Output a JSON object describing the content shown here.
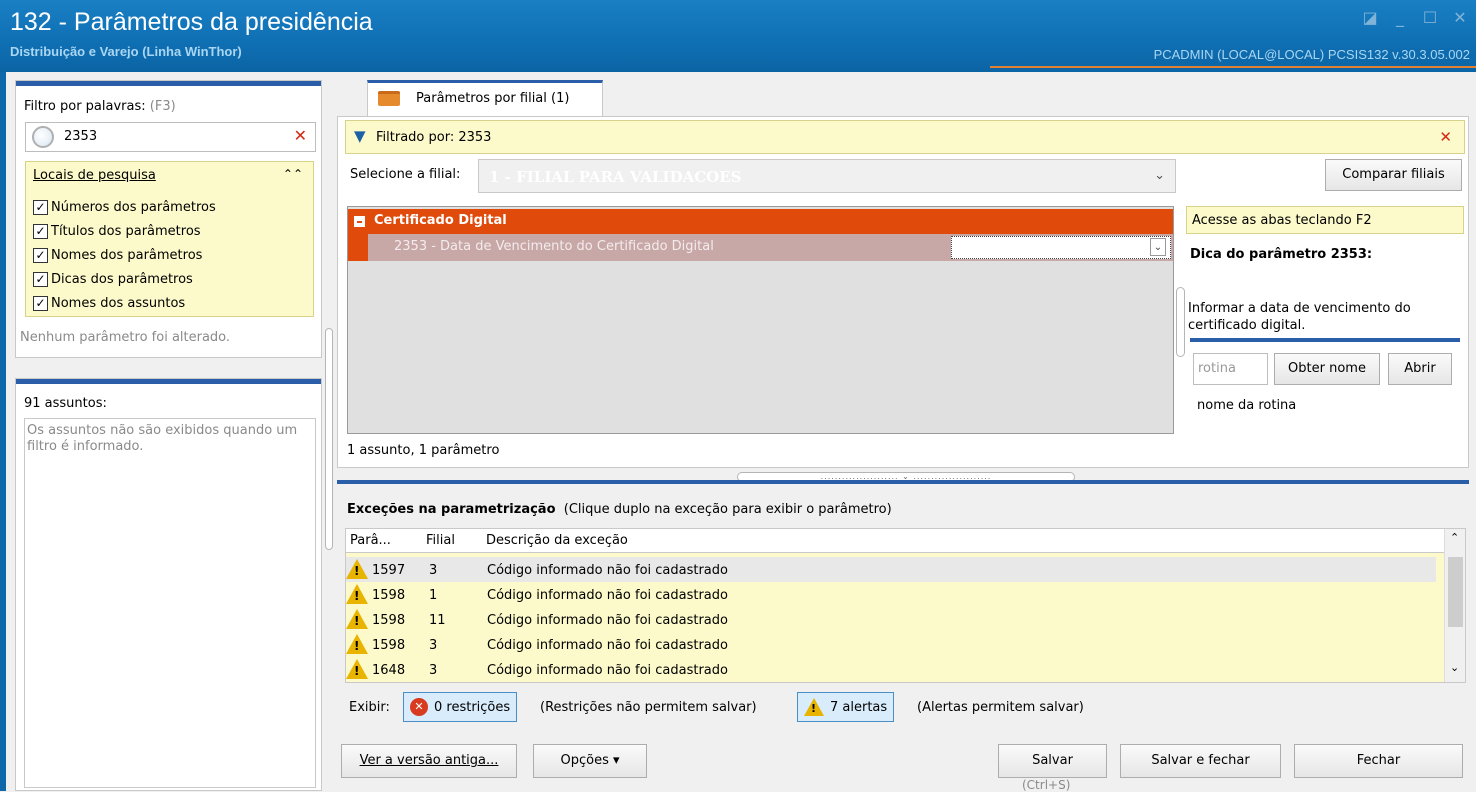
{
  "window": {
    "title": "132 - Parâmetros da presidência",
    "subtitle": "Distribuição e Varejo (Linha WinThor)",
    "user_info": "PCADMIN (LOCAL@LOCAL)   PCSIS132  v.30.3.05.002"
  },
  "filter": {
    "label": "Filtro por palavras:",
    "shortcut": "(F3)",
    "value": "2353",
    "clear": "✕"
  },
  "locais": {
    "title": "Locais de pesquisa",
    "items": [
      "Números dos parâmetros",
      "Títulos dos parâmetros",
      "Nomes dos parâmetros",
      "Dicas dos parâmetros",
      "Nomes dos assuntos"
    ]
  },
  "status_changed": "Nenhum parâmetro foi alterado.",
  "subjects": {
    "count_label": "91 assuntos:",
    "note": "Os assuntos não são exibidos quando um filtro é informado."
  },
  "tab": {
    "label": "Parâmetros por filial  (1)"
  },
  "filtered_by": "Filtrado por: 2353",
  "filial": {
    "label": "Selecione a filial:",
    "value": "1 - FILIAL PARA VALIDACOES",
    "compare_button": "Comparar filiais"
  },
  "grid": {
    "group": "Certificado Digital",
    "param_row": "2353 - Data de Vencimento do Certificado Digital",
    "footer": "1 assunto, 1 parâmetro"
  },
  "side": {
    "hint_bar": "Acesse as abas teclando F2",
    "dica_title": "Dica do parâmetro 2353:",
    "dica_text": "Informar a data de vencimento do certificado digital.",
    "rotina_placeholder": "rotina",
    "obter_nome": "Obter nome",
    "abrir": "Abrir",
    "nome_rotina": "nome da rotina"
  },
  "exceptions": {
    "title": "Exceções na parametrização",
    "subtitle": "(Clique duplo na exceção para exibir o parâmetro)",
    "columns": [
      "Parâ...",
      "Filial",
      "Descrição da exceção"
    ],
    "rows": [
      {
        "param": "1597",
        "filial": "3",
        "desc": "Código informado não foi cadastrado"
      },
      {
        "param": "1598",
        "filial": "1",
        "desc": "Código informado não foi cadastrado"
      },
      {
        "param": "1598",
        "filial": "11",
        "desc": "Código informado não foi cadastrado"
      },
      {
        "param": "1598",
        "filial": "3",
        "desc": "Código informado não foi cadastrado"
      },
      {
        "param": "1648",
        "filial": "3",
        "desc": "Código informado não foi cadastrado"
      }
    ],
    "exibir_label": "Exibir:",
    "restricoes": "0 restrições",
    "restricoes_note": "(Restrições não permitem salvar)",
    "alertas": "7 alertas",
    "alertas_note": "(Alertas permitem salvar)"
  },
  "footer_buttons": {
    "versao_antiga": "Ver a versão antiga...",
    "opcoes": "Opções ▾",
    "salvar": "Salvar",
    "salvar_hint": "(Ctrl+S)",
    "salvar_fechar": "Salvar e fechar",
    "fechar": "Fechar"
  },
  "colors": {
    "accent": "#2a5ea8",
    "title_bg": "#0f6fb3",
    "group_row": "#e04a0a",
    "yellow_bg": "#fcfaca"
  }
}
